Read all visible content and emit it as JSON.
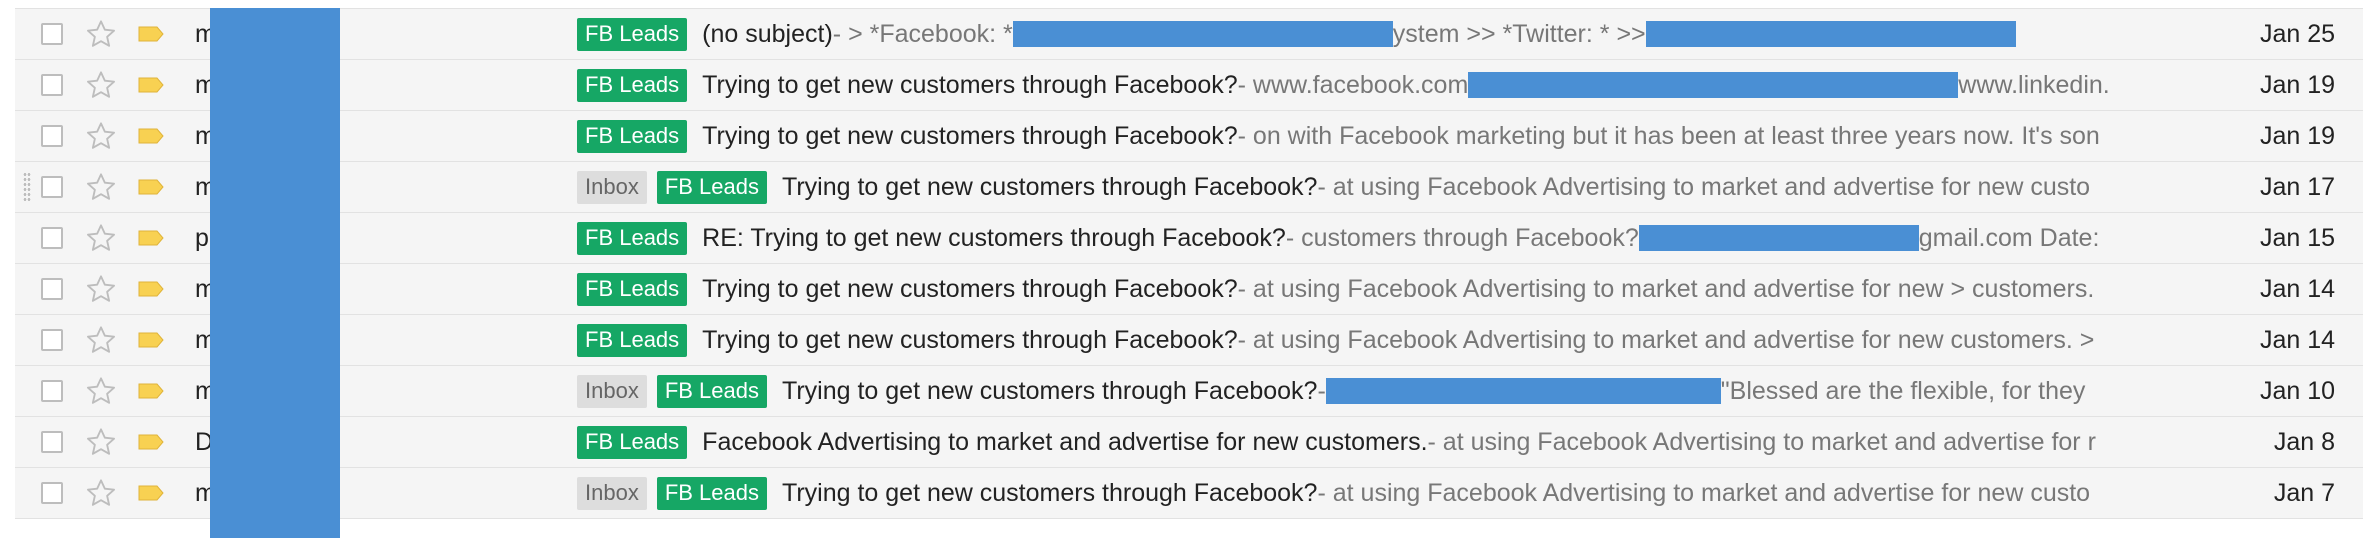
{
  "colors": {
    "fb_label": "#16a765",
    "inbox_label": "#dddddd",
    "redaction": "#4a8fd4",
    "tag_icon": "#f8d152",
    "row_bg": "#f5f5f5"
  },
  "icons": {
    "checkbox": "checkbox-icon",
    "star": "star-icon",
    "importance": "importance-marker-icon"
  },
  "rows": [
    {
      "sender": "m                 o",
      "labels": [
        "FB Leads"
      ],
      "subject": "(no subject)",
      "snippet_a": " - > *Facebook: *",
      "snippet_b": "ystem >> *Twitter: * >> ",
      "snippet_c": "",
      "date": "Jan 25"
    },
    {
      "sender": "m                  (3)",
      "labels": [
        "FB Leads"
      ],
      "subject": "Trying to get new customers through Facebook?",
      "snippet_a": " - www.facebook.com",
      "snippet_b": " www.linkedin.",
      "snippet_c": "",
      "date": "Jan 19"
    },
    {
      "sender": "m                a (2)",
      "labels": [
        "FB Leads"
      ],
      "subject": "Trying to get new customers through Facebook?",
      "snippet_a": " - on with Facebook marketing but it has been at least three years now. It's son",
      "snippet_b": "",
      "snippet_c": "",
      "date": "Jan 19"
    },
    {
      "sender": "m                 )",
      "labels": [
        "Inbox",
        "FB Leads"
      ],
      "subject": "Trying to get new customers through Facebook?",
      "snippet_a": " - at using Facebook Advertising to market and advertise for new custo",
      "snippet_b": "",
      "snippet_c": "",
      "date": "Jan 17"
    },
    {
      "sender": "p                2)",
      "labels": [
        "FB Leads"
      ],
      "subject": "RE: Trying to get new customers through Facebook?",
      "snippet_a": " - customers through Facebook?",
      "snippet_b": "gmail.com Date:",
      "snippet_c": "",
      "date": "Jan 15"
    },
    {
      "sender": "m                 )",
      "labels": [
        "FB Leads"
      ],
      "subject": "Trying to get new customers through Facebook?",
      "snippet_a": " - at using Facebook Advertising to market and advertise for new > customers.",
      "snippet_b": "",
      "snippet_c": "",
      "date": "Jan 14"
    },
    {
      "sender": "m                (3)",
      "labels": [
        "FB Leads"
      ],
      "subject": "Trying to get new customers through Facebook?",
      "snippet_a": " - at using Facebook Advertising to market and advertise for new customers. >",
      "snippet_b": "",
      "snippet_c": "",
      "date": "Jan 14"
    },
    {
      "sender": "m",
      "labels": [
        "Inbox",
        "FB Leads"
      ],
      "subject": "Trying to get new customers through Facebook?",
      "snippet_a": " -",
      "snippet_b": " \"Blessed are the flexible, for they",
      "snippet_c": "",
      "date": "Jan 10"
    },
    {
      "sender": "D                n",
      "labels": [
        "FB Leads"
      ],
      "subject": "Facebook Advertising to market and advertise for new customers.",
      "snippet_a": " - at using Facebook Advertising to market and advertise for r",
      "snippet_b": "",
      "snippet_c": "",
      "date": "Jan 8"
    },
    {
      "sender": "m                an (4)",
      "labels": [
        "Inbox",
        "FB Leads"
      ],
      "subject": "Trying to get new customers through Facebook?",
      "snippet_a": " - at using Facebook Advertising to market and advertise for new custo",
      "snippet_b": "",
      "snippet_c": "",
      "date": "Jan 7"
    }
  ]
}
